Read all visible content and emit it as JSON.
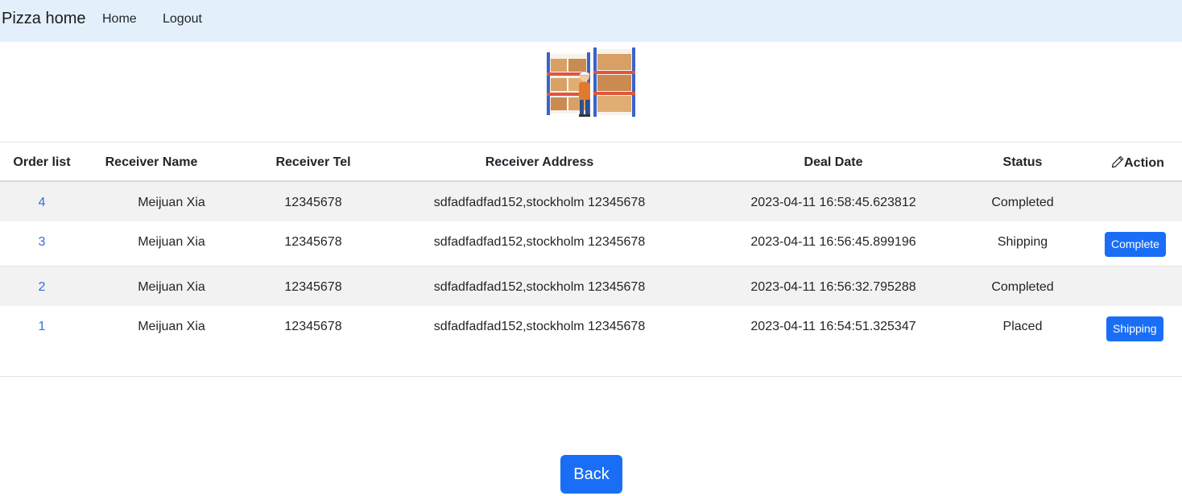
{
  "navbar": {
    "brand": "Pizza home",
    "links": [
      "Home",
      "Logout"
    ]
  },
  "table": {
    "headers": [
      "Order list",
      "Receiver Name",
      "Receiver Tel",
      "Receiver Address",
      "Deal Date",
      "Status",
      "Action"
    ],
    "action_icon": "pencil-icon",
    "rows": [
      {
        "order": "4",
        "name": "Meijuan Xia",
        "tel": "12345678",
        "address": "sdfadfadfad152,stockholm 12345678",
        "date": "2023-04-11 16:58:45.623812",
        "status": "Completed",
        "action": ""
      },
      {
        "order": "3",
        "name": "Meijuan Xia",
        "tel": "12345678",
        "address": "sdfadfadfad152,stockholm 12345678",
        "date": "2023-04-11 16:56:45.899196",
        "status": "Shipping",
        "action": "Complete"
      },
      {
        "order": "2",
        "name": "Meijuan Xia",
        "tel": "12345678",
        "address": "sdfadfadfad152,stockholm 12345678",
        "date": "2023-04-11 16:56:32.795288",
        "status": "Completed",
        "action": ""
      },
      {
        "order": "1",
        "name": "Meijuan Xia",
        "tel": "12345678",
        "address": "sdfadfadfad152,stockholm 12345678",
        "date": "2023-04-11 16:54:51.325347",
        "status": "Placed",
        "action": "Shipping"
      }
    ]
  },
  "back_label": "Back",
  "colors": {
    "navbar_bg": "#e3f0fc",
    "primary": "#1a6ef5",
    "link": "#2f6fdf",
    "stripe": "#f2f2f2"
  }
}
